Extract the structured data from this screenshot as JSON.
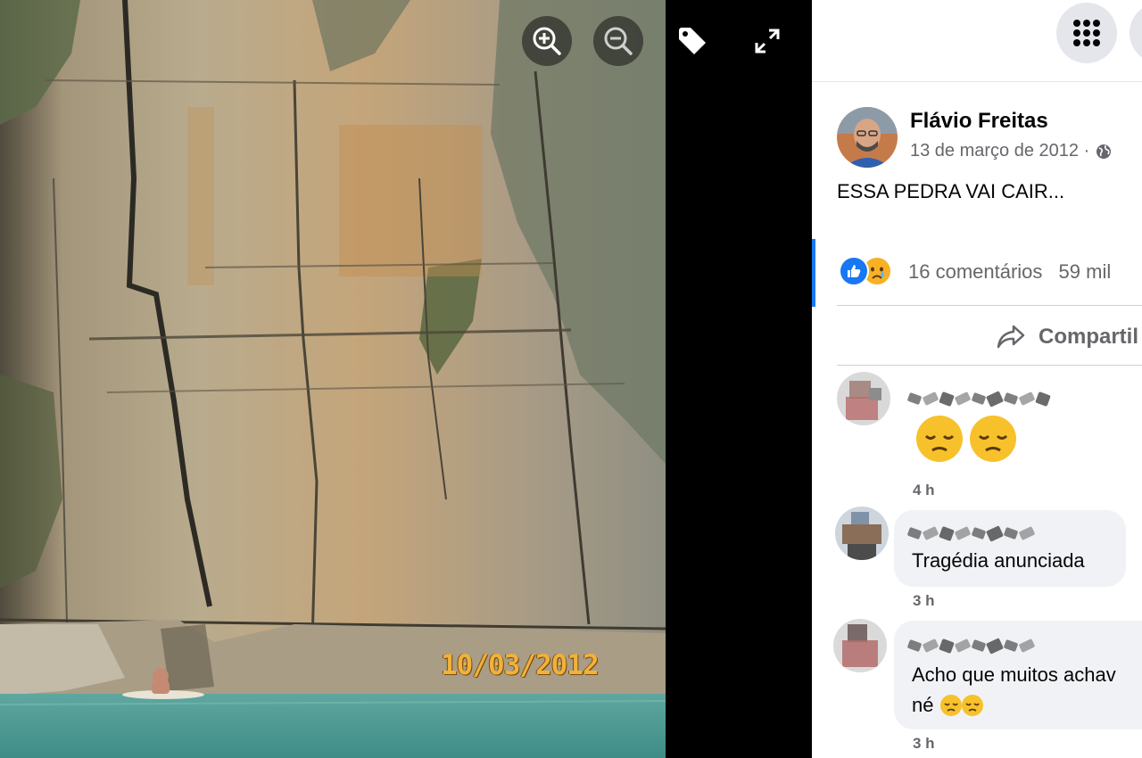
{
  "viewer": {
    "photo_date": "10/03/2012",
    "controls": [
      "zoom-in-icon",
      "zoom-out-icon",
      "tag-icon",
      "fullscreen-icon"
    ]
  },
  "post": {
    "author": "Flávio Freitas",
    "date": "13 de março de 2012 ·",
    "privacy_icon": "globe-icon",
    "text": "ESSA PEDRA VAI CAIR...",
    "reactions": [
      "like-icon",
      "sad-icon"
    ],
    "comments_count": "16 comentários",
    "views_count": "59 mil",
    "share_label": "Compartil"
  },
  "comments": [
    {
      "emoji": "😔😔",
      "time": "4 h"
    },
    {
      "text": "Tragédia anunciada",
      "time": "3 h"
    },
    {
      "text_line1": "Acho que muitos achav",
      "text_line2": "né",
      "text_line2_emoji": "😔😔",
      "time": "3 h"
    }
  ],
  "colors": {
    "accent": "#1877f2",
    "secondary_text": "#65676b",
    "bubble": "#f0f2f5",
    "date_stamp": "#f1b23b"
  }
}
